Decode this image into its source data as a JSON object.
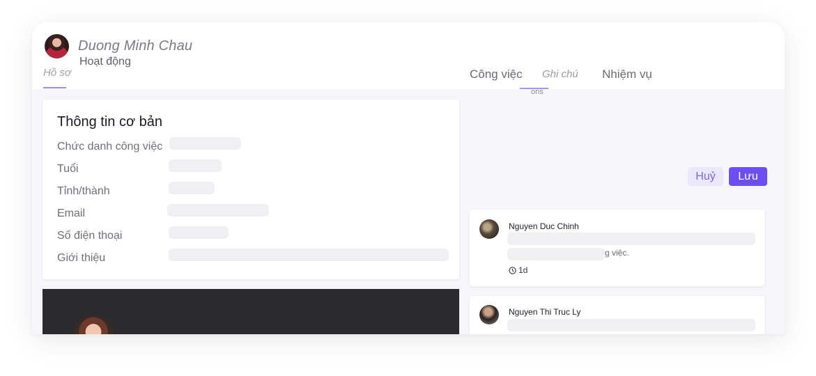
{
  "header": {
    "user_name": "Duong Minh Chau",
    "tabs": {
      "activity": "Hoạt động",
      "profile": "Hồ sơ",
      "work": "Công việc",
      "notes": "Ghi chú",
      "tasks": "Nhiệm vụ"
    },
    "fragment": "ons"
  },
  "info": {
    "title": "Thông tin cơ bản",
    "labels": [
      "Chức danh công việc",
      "Tuổi",
      "Tỉnh/thành",
      "Email",
      "Số điện thoại",
      "Giới thiệu"
    ]
  },
  "actions": {
    "cancel": "Huỷ",
    "save": "Lưu"
  },
  "comments": [
    {
      "name": "Nguyen Duc Chinh",
      "text_fragment": "g việc.",
      "time": "1d"
    },
    {
      "name": "Nguyen Thi Truc Ly"
    }
  ],
  "colors": {
    "accent": "#6b4ff0",
    "accent_light": "#ebe7fd",
    "skeleton": "#f0f0f3",
    "panel_bg": "#f6f6fb"
  }
}
